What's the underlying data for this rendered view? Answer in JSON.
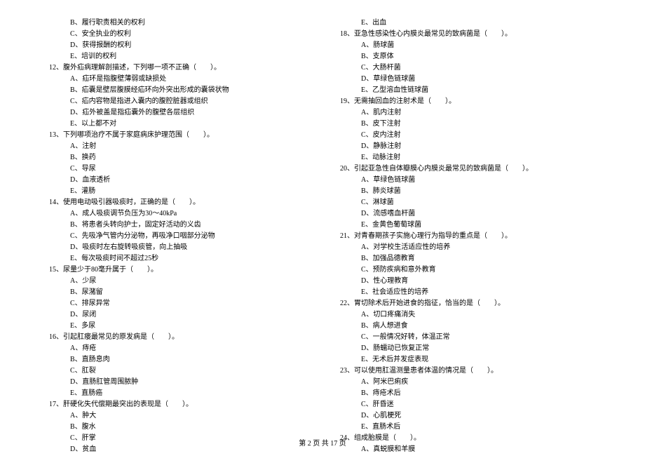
{
  "left_column": [
    {
      "type": "option",
      "text": "B、履行职责相关的权利"
    },
    {
      "type": "option",
      "text": "C、安全执业的权利"
    },
    {
      "type": "option",
      "text": "D、获得报酬的权利"
    },
    {
      "type": "option",
      "text": "E、培训的权利"
    },
    {
      "type": "question",
      "text": "12、腹外疝病理解剖描述，下列哪一项不正确（　　）。"
    },
    {
      "type": "option",
      "text": "A、疝环是指腹壁薄弱或缺损处"
    },
    {
      "type": "option",
      "text": "B、疝囊是壁层腹膜经疝环向外突出形成的囊袋状物"
    },
    {
      "type": "option",
      "text": "C、疝内容物是指进入囊内的腹腔脏器或组织"
    },
    {
      "type": "option",
      "text": "D、疝外被盖是指疝囊外的腹壁各层组织"
    },
    {
      "type": "option",
      "text": "E、以上都不对"
    },
    {
      "type": "question",
      "text": "13、下列哪项治疗不属于家庭病床护理范围（　　）。"
    },
    {
      "type": "option",
      "text": "A、注射"
    },
    {
      "type": "option",
      "text": "B、换药"
    },
    {
      "type": "option",
      "text": "C、导尿"
    },
    {
      "type": "option",
      "text": "D、血液透析"
    },
    {
      "type": "option",
      "text": "E、灌肠"
    },
    {
      "type": "question",
      "text": "14、使用电动吸引器吸痰时，正确的是（　　）。"
    },
    {
      "type": "option",
      "text": "A、成人吸痰调节负压为30～40kPa"
    },
    {
      "type": "option",
      "text": "B、将患者头转向护士，固定好活动的义齿"
    },
    {
      "type": "option",
      "text": "C、先吸净气管内分泌物，再吸净口咽部分泌物"
    },
    {
      "type": "option",
      "text": "D、吸痰时左右旋转吸痰管，向上抽吸"
    },
    {
      "type": "option",
      "text": "E、每次吸痰时间不超过25秒"
    },
    {
      "type": "question",
      "text": "15、尿量少于80毫升属于（　　）。"
    },
    {
      "type": "option",
      "text": "A、少尿"
    },
    {
      "type": "option",
      "text": "B、尿潴留"
    },
    {
      "type": "option",
      "text": "C、排尿异常"
    },
    {
      "type": "option",
      "text": "D、尿闭"
    },
    {
      "type": "option",
      "text": "E、多尿"
    },
    {
      "type": "question",
      "text": "16、引起肛瘘最常见的原发病是（　　）。"
    },
    {
      "type": "option",
      "text": "A、痔疮"
    },
    {
      "type": "option",
      "text": "B、直肠息肉"
    },
    {
      "type": "option",
      "text": "C、肛裂"
    },
    {
      "type": "option",
      "text": "D、直肠肛管周围脓肿"
    },
    {
      "type": "option",
      "text": "E、直肠癌"
    },
    {
      "type": "question",
      "text": "17、肝硬化失代偿期最突出的表现是（　　）。"
    },
    {
      "type": "option",
      "text": "A、肿大"
    },
    {
      "type": "option",
      "text": "B、腹水"
    },
    {
      "type": "option",
      "text": "C、肝掌"
    },
    {
      "type": "option",
      "text": "D、贫血"
    }
  ],
  "right_column": [
    {
      "type": "option",
      "text": "E、出血"
    },
    {
      "type": "question",
      "text": "18、亚急性感染性心内膜炎最常见的致病菌是（　　）。"
    },
    {
      "type": "option",
      "text": "A、肠球菌"
    },
    {
      "type": "option",
      "text": "B、支原体"
    },
    {
      "type": "option",
      "text": "C、大肠杆菌"
    },
    {
      "type": "option",
      "text": "D、草绿色链球菌"
    },
    {
      "type": "option",
      "text": "E、乙型溶血性链球菌"
    },
    {
      "type": "question",
      "text": "19、无需抽回血的注射术是（　　）。"
    },
    {
      "type": "option",
      "text": "A、肌内注射"
    },
    {
      "type": "option",
      "text": "B、皮下注射"
    },
    {
      "type": "option",
      "text": "C、皮内注射"
    },
    {
      "type": "option",
      "text": "D、静脉注射"
    },
    {
      "type": "option",
      "text": "E、动脉注射"
    },
    {
      "type": "question",
      "text": "20、引起亚急性自体瓣膜心内膜炎最常见的致病菌是（　　）。"
    },
    {
      "type": "option",
      "text": "A、草绿色链球菌"
    },
    {
      "type": "option",
      "text": "B、肺炎球菌"
    },
    {
      "type": "option",
      "text": "C、淋球菌"
    },
    {
      "type": "option",
      "text": "D、流感嗜血杆菌"
    },
    {
      "type": "option",
      "text": "E、金黄色葡萄球菌"
    },
    {
      "type": "question",
      "text": "21、对青春期孩子实施心理行为指导的重点是（　　）。"
    },
    {
      "type": "option",
      "text": "A、对学校生活适应性的培养"
    },
    {
      "type": "option",
      "text": "B、加强品德教育"
    },
    {
      "type": "option",
      "text": "C、预防疾病和意外教育"
    },
    {
      "type": "option",
      "text": "D、性心理教育"
    },
    {
      "type": "option",
      "text": "E、社会适应性的培养"
    },
    {
      "type": "question",
      "text": "22、胃切除术后开始进食的指征，恰当的是（　　）。"
    },
    {
      "type": "option",
      "text": "A、切口疼痛消失"
    },
    {
      "type": "option",
      "text": "B、病人想进食"
    },
    {
      "type": "option",
      "text": "C、一般情况好转，体温正常"
    },
    {
      "type": "option",
      "text": "D、肠蠕动已恢复正常"
    },
    {
      "type": "option",
      "text": "E、无术后并发症表现"
    },
    {
      "type": "question",
      "text": "23、可以使用肛温测量患者体温的情况是（　　）。"
    },
    {
      "type": "option",
      "text": "A、阿米巴痢疾"
    },
    {
      "type": "option",
      "text": "B、痔疮术后"
    },
    {
      "type": "option",
      "text": "C、肝昏迷"
    },
    {
      "type": "option",
      "text": "D、心肌梗死"
    },
    {
      "type": "option",
      "text": "E、直肠术后"
    },
    {
      "type": "question",
      "text": "24、组成胎膜是（　　）。"
    },
    {
      "type": "option",
      "text": "A、真蜕膜和羊膜"
    }
  ],
  "footer": "第 2 页 共 17 页"
}
